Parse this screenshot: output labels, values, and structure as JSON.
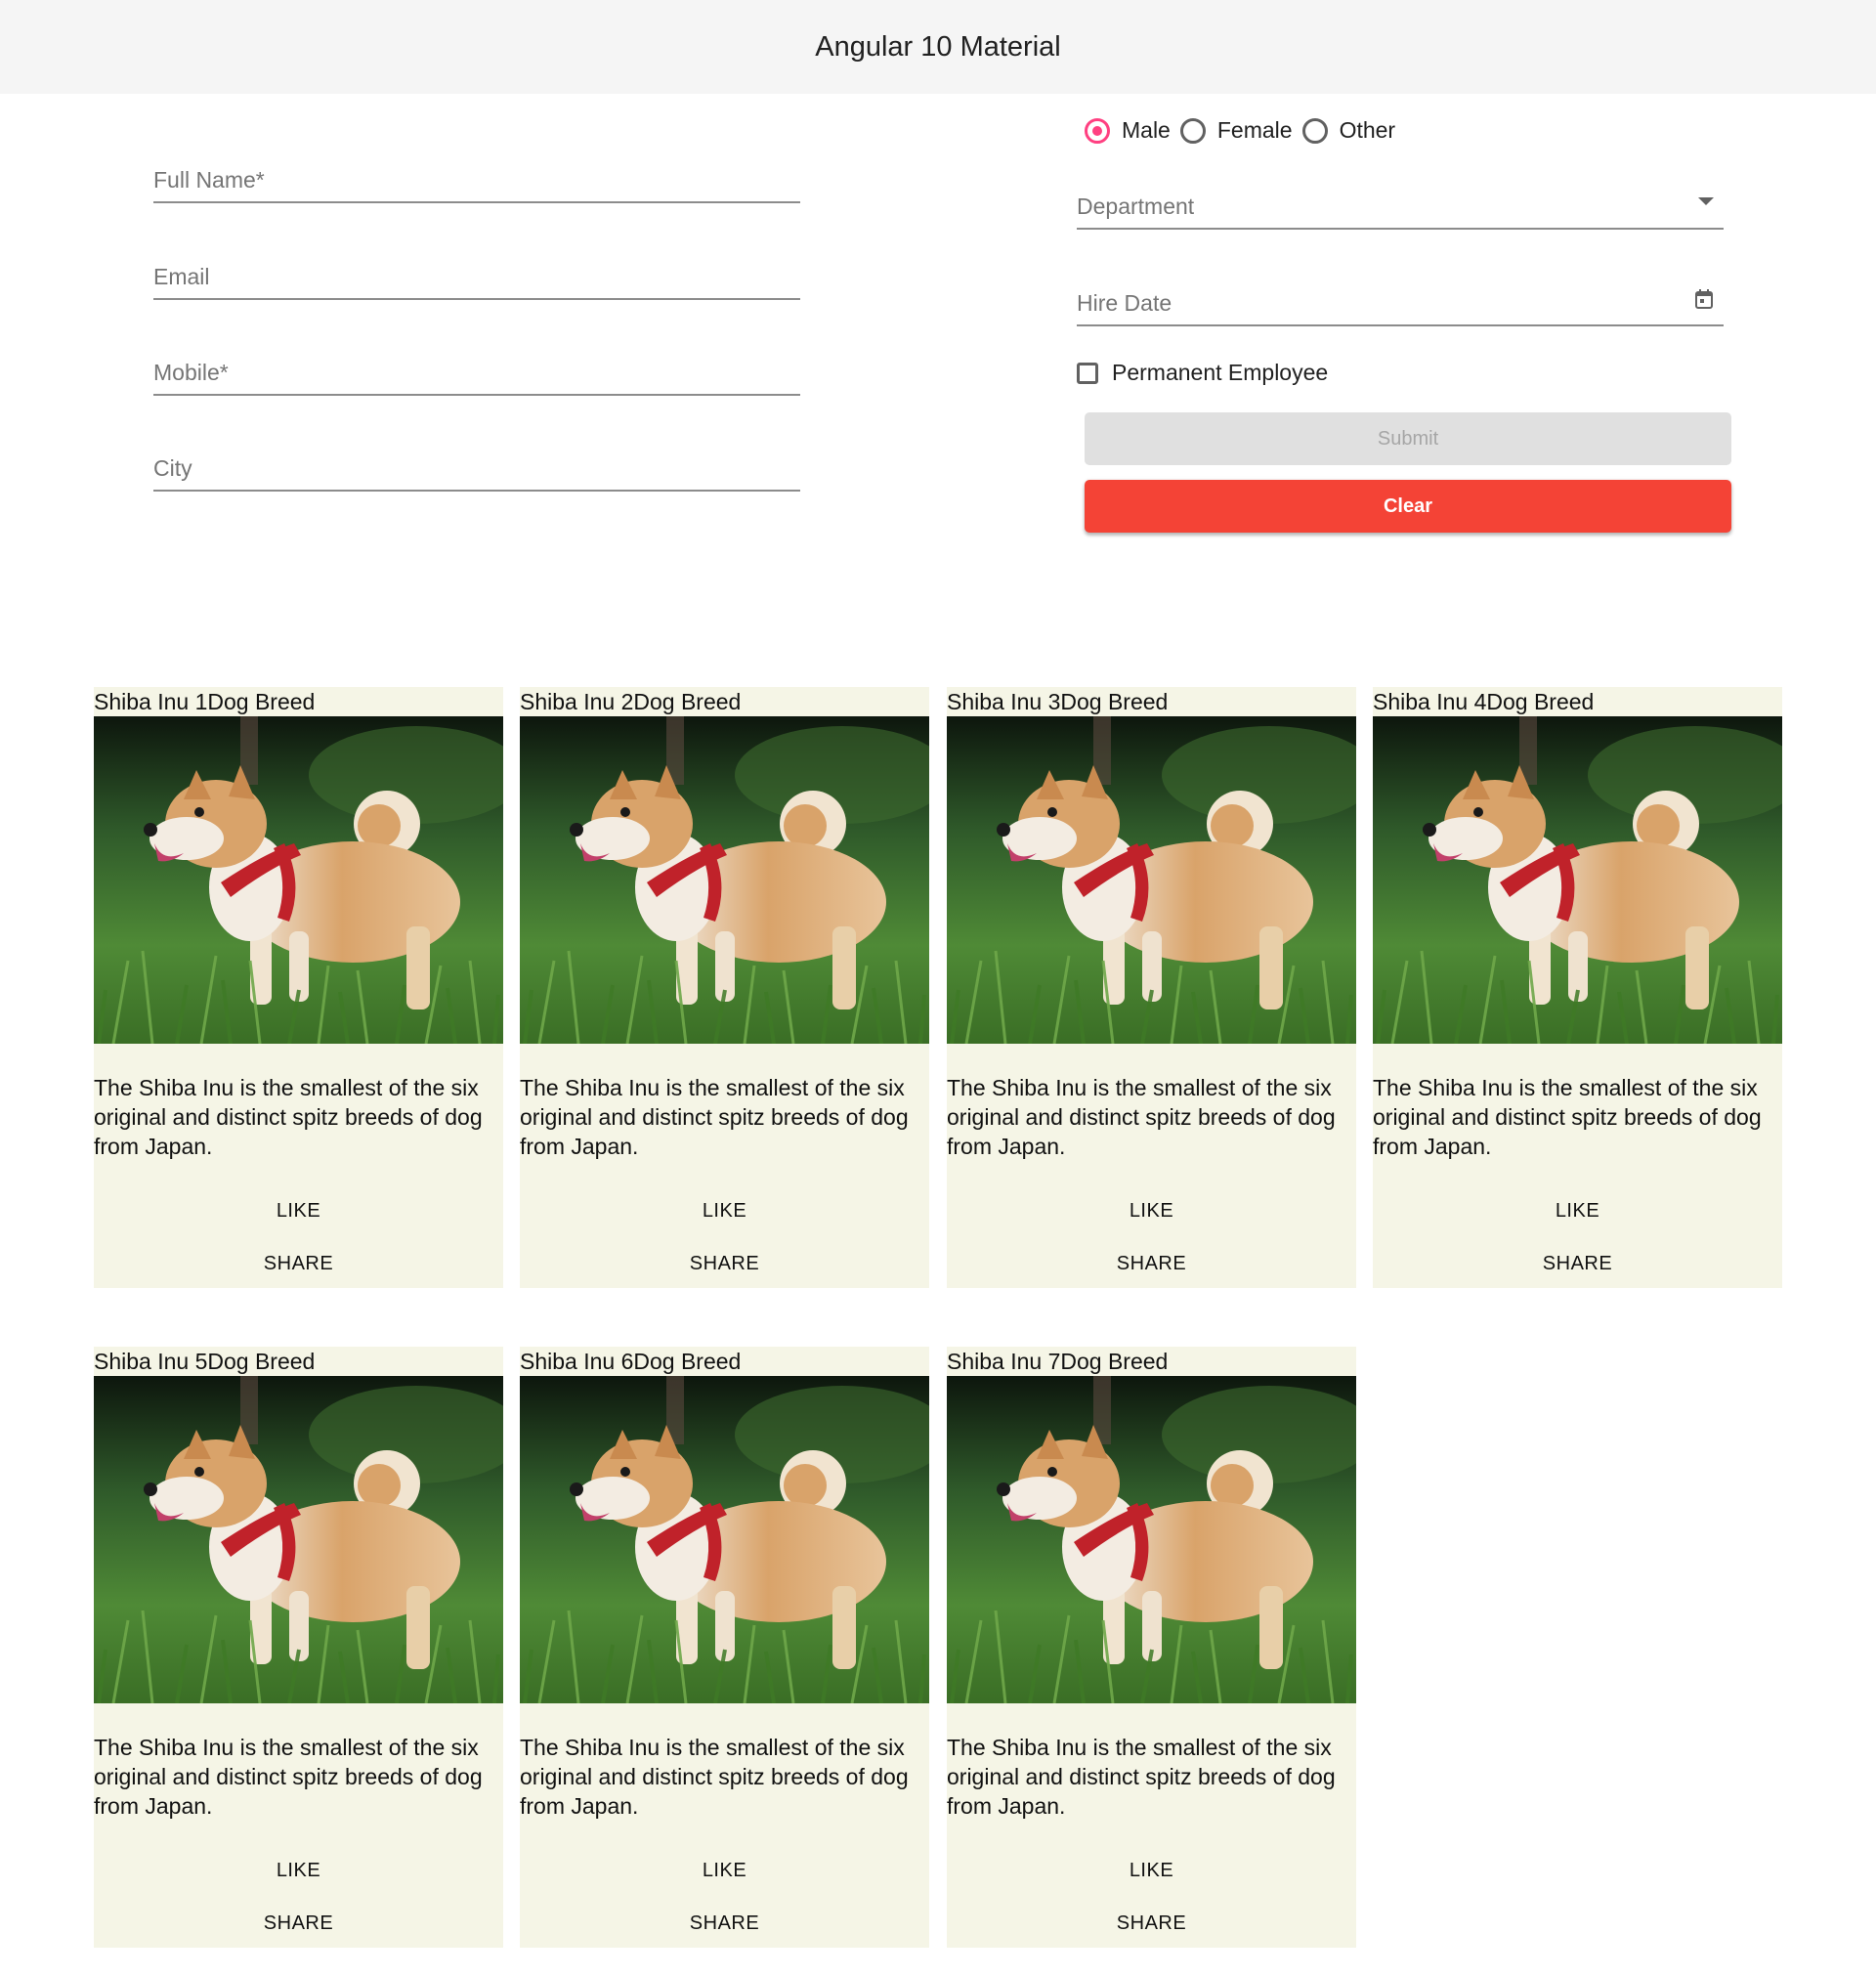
{
  "app": {
    "title": "Angular 10 Material"
  },
  "form": {
    "full_name_placeholder": "Full Name*",
    "email_placeholder": "Email",
    "mobile_placeholder": "Mobile*",
    "city_placeholder": "City",
    "gender_options": [
      "Male",
      "Female",
      "Other"
    ],
    "gender_selected": "Male",
    "department_placeholder": "Department",
    "hire_date_placeholder": "Hire Date",
    "permanent_label": "Permanent Employee",
    "permanent_checked": false,
    "submit_label": "Submit",
    "clear_label": "Clear"
  },
  "cards": [
    {
      "title": "Shiba Inu 1Dog Breed",
      "description": "The Shiba Inu is the smallest of the six original and distinct spitz breeds of dog from Japan.",
      "like_label": "LIKE",
      "share_label": "SHARE"
    },
    {
      "title": "Shiba Inu 2Dog Breed",
      "description": "The Shiba Inu is the smallest of the six original and distinct spitz breeds of dog from Japan.",
      "like_label": "LIKE",
      "share_label": "SHARE"
    },
    {
      "title": "Shiba Inu 3Dog Breed",
      "description": "The Shiba Inu is the smallest of the six original and distinct spitz breeds of dog from Japan.",
      "like_label": "LIKE",
      "share_label": "SHARE"
    },
    {
      "title": "Shiba Inu 4Dog Breed",
      "description": "The Shiba Inu is the smallest of the six original and distinct spitz breeds of dog from Japan.",
      "like_label": "LIKE",
      "share_label": "SHARE"
    },
    {
      "title": "Shiba Inu 5Dog Breed",
      "description": "The Shiba Inu is the smallest of the six original and distinct spitz breeds of dog from Japan.",
      "like_label": "LIKE",
      "share_label": "SHARE"
    },
    {
      "title": "Shiba Inu 6Dog Breed",
      "description": "The Shiba Inu is the smallest of the six original and distinct spitz breeds of dog from Japan.",
      "like_label": "LIKE",
      "share_label": "SHARE"
    },
    {
      "title": "Shiba Inu 7Dog Breed",
      "description": "The Shiba Inu is the smallest of the six original and distinct spitz breeds of dog from Japan.",
      "like_label": "LIKE",
      "share_label": "SHARE"
    }
  ],
  "colors": {
    "accent": "#ff4081",
    "warn": "#f44336",
    "card_bg": "#f5f5e6",
    "toolbar_bg": "#f5f5f5"
  },
  "icons": {
    "department_trailing": "dropdown-arrow-icon",
    "hire_date_trailing": "calendar-icon"
  }
}
